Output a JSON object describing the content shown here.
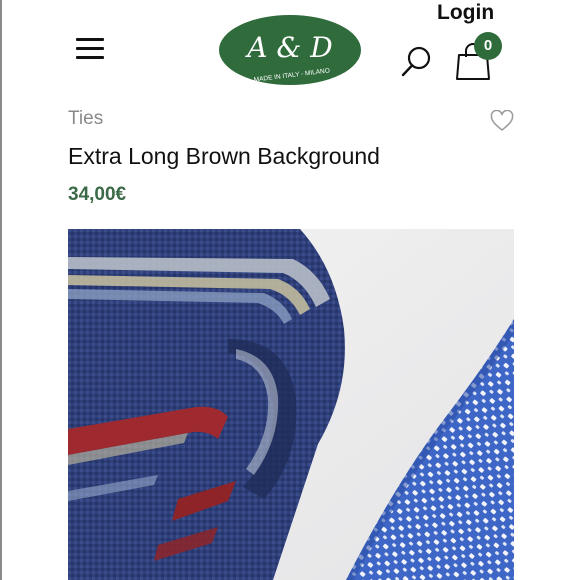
{
  "header": {
    "logo": {
      "monogram": "A & D",
      "tagline": "MADE IN ITALY - MILANO",
      "color": "#2f6b3b"
    },
    "login_label": "Login",
    "cart_count": "0",
    "accent": "#2f6b3b",
    "icons": {
      "menu": "hamburger-menu-icon",
      "search": "search-icon",
      "cart": "shopping-bag-icon"
    }
  },
  "product": {
    "category": "Ties",
    "name": "Extra Long Brown Background",
    "price": "34,00€",
    "price_color": "#3b6a47",
    "wishlist_icon": "heart-icon",
    "image_alt": ""
  }
}
